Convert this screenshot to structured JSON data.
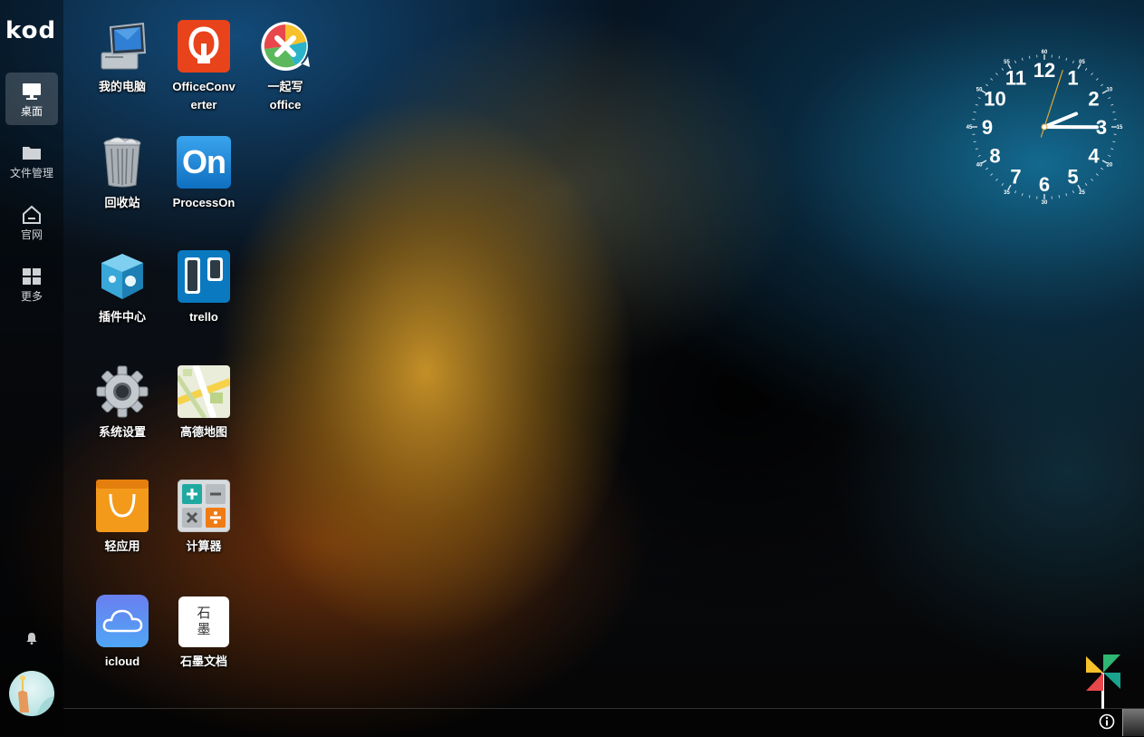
{
  "brand": {
    "logo_text": "kod"
  },
  "sidebar": {
    "items": [
      {
        "label": "桌面",
        "icon": "monitor-icon",
        "active": true
      },
      {
        "label": "文件管理",
        "icon": "folder-icon",
        "active": false
      },
      {
        "label": "官网",
        "icon": "home-icon",
        "active": false
      },
      {
        "label": "更多",
        "icon": "grid-icon",
        "active": false
      }
    ],
    "notification_icon": "bell-icon",
    "avatar_icon": "user-avatar"
  },
  "desktop": {
    "icons": [
      {
        "label": "我的电脑",
        "icon": "computer-icon"
      },
      {
        "label": "OfficeConverter",
        "icon": "officeconverter-icon"
      },
      {
        "label": "一起写office",
        "icon": "yiqixie-icon"
      },
      {
        "label": "回收站",
        "icon": "recycle-bin-icon"
      },
      {
        "label": "ProcessOn",
        "icon": "processon-icon"
      },
      {
        "label": "插件中心",
        "icon": "plugin-center-icon"
      },
      {
        "label": "trello",
        "icon": "trello-icon"
      },
      {
        "label": "系统设置",
        "icon": "gear-icon"
      },
      {
        "label": "高德地图",
        "icon": "map-icon"
      },
      {
        "label": "轻应用",
        "icon": "shopping-bag-icon"
      },
      {
        "label": "计算器",
        "icon": "calculator-icon"
      },
      {
        "label": "icloud",
        "icon": "cloud-icon"
      },
      {
        "label": "石墨文档",
        "icon": "shimo-icon"
      }
    ],
    "icon_labels_wrapped": {
      "officeconverter": [
        "OfficeConv",
        "erter"
      ],
      "yiqixie": [
        "一起写",
        "office"
      ]
    },
    "shimo_glyphs": [
      "石",
      "墨"
    ],
    "processon_glyph": "On"
  },
  "clock": {
    "hours": [
      "12",
      "1",
      "2",
      "3",
      "4",
      "5",
      "6",
      "7",
      "8",
      "9",
      "10",
      "11"
    ],
    "minute_marks": [
      "60",
      "05",
      "10",
      "15",
      "20",
      "25",
      "30",
      "35",
      "40",
      "45",
      "50",
      "55"
    ],
    "time": {
      "hour": 2,
      "minute": 15,
      "second": 3
    }
  },
  "taskbar": {
    "info_icon": "info-icon",
    "show_desktop_icon": "show-desktop-button",
    "pinwheel_icon": "pinwheel-icon"
  },
  "colors": {
    "officeconverter": "#e8431b",
    "processon": "#1e88d6",
    "trello": "#0a79bf",
    "shopping": "#f39a1b",
    "icloud": "#5a8cf0"
  }
}
